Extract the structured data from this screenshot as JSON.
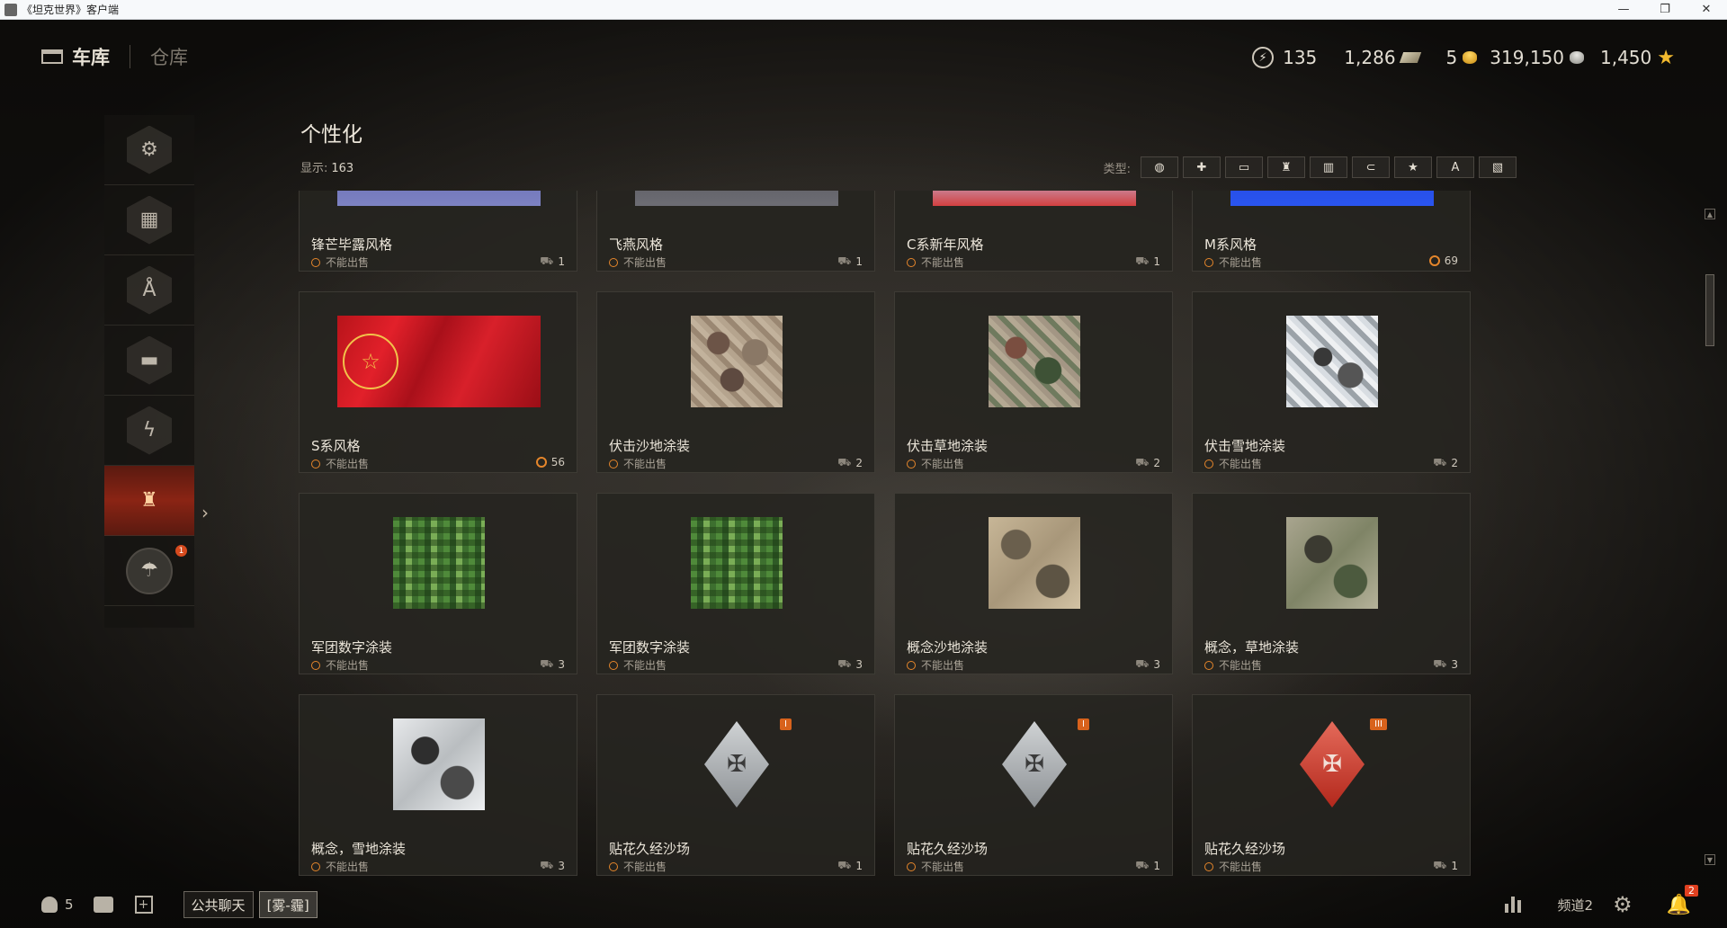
{
  "window": {
    "title": "《坦克世界》客户端",
    "buttons": [
      "—",
      "❐",
      "✕"
    ]
  },
  "header": {
    "garage_label": "车库",
    "depot_label": "仓库",
    "currencies": {
      "free_xp": "135",
      "bonds": "1,286",
      "gold_a": "5",
      "credits": "319,150",
      "crystal": "1,450"
    }
  },
  "sidebar": {
    "items": [
      {
        "icon": "equipment-icon"
      },
      {
        "icon": "ammo-crates-icon"
      },
      {
        "icon": "crew-icon"
      },
      {
        "icon": "tank-icon"
      },
      {
        "icon": "free-xp-icon"
      },
      {
        "icon": "brush-icon",
        "active": true
      },
      {
        "icon": "parachute-icon",
        "badge": "1"
      }
    ]
  },
  "main": {
    "title": "个性化",
    "count_label": "显示:",
    "count": "163",
    "filter_label": "类型:",
    "filters": [
      "paint-icon",
      "camo-icon",
      "emblem-icon",
      "brush-icon",
      "decal-icon",
      "projection-icon",
      "star-icon",
      "text-icon",
      "remove-icon"
    ]
  },
  "status_text": "不能出售",
  "cards": [
    {
      "name": "锋芒毕露风格",
      "qty": "1",
      "thumb": "banner",
      "fill": "fill-b1",
      "qty_type": "tank"
    },
    {
      "name": "飞燕风格",
      "qty": "1",
      "thumb": "banner",
      "fill": "fill-b2",
      "qty_type": "tank"
    },
    {
      "name": "C系新年风格",
      "qty": "1",
      "thumb": "banner",
      "fill": "fill-b3",
      "qty_type": "tank"
    },
    {
      "name": "M系风格",
      "qty": "69",
      "thumb": "banner",
      "fill": "fill-b4",
      "qty_type": "alt"
    },
    {
      "name": "S系风格",
      "qty": "56",
      "thumb": "banner",
      "fill": "fill-red",
      "qty_type": "alt"
    },
    {
      "name": "伏击沙地涂装",
      "qty": "2",
      "thumb": "square",
      "fill": "fill-sand",
      "qty_type": "tank"
    },
    {
      "name": "伏击草地涂装",
      "qty": "2",
      "thumb": "square",
      "fill": "fill-grass",
      "qty_type": "tank"
    },
    {
      "name": "伏击雪地涂装",
      "qty": "2",
      "thumb": "square",
      "fill": "fill-snow",
      "qty_type": "tank"
    },
    {
      "name": "军团数字涂装",
      "qty": "3",
      "thumb": "square",
      "fill": "fill-digital",
      "qty_type": "tank"
    },
    {
      "name": "军团数字涂装",
      "qty": "3",
      "thumb": "square",
      "fill": "fill-digital",
      "qty_type": "tank"
    },
    {
      "name": "概念沙地涂装",
      "qty": "3",
      "thumb": "square",
      "fill": "fill-c-sand",
      "qty_type": "tank"
    },
    {
      "name": "概念，草地涂装",
      "qty": "3",
      "thumb": "square",
      "fill": "fill-c-grass",
      "qty_type": "tank"
    },
    {
      "name": "概念，雪地涂装",
      "qty": "3",
      "thumb": "square",
      "fill": "fill-c-snow",
      "qty_type": "tank"
    },
    {
      "name": "贴花久经沙场",
      "qty": "1",
      "thumb": "decal",
      "decal": "grey",
      "level": "I",
      "qty_type": "tank"
    },
    {
      "name": "贴花久经沙场",
      "qty": "1",
      "thumb": "decal",
      "decal": "grey",
      "level": "I",
      "qty_type": "tank"
    },
    {
      "name": "贴花久经沙场",
      "qty": "1",
      "thumb": "decal",
      "decal": "red",
      "level": "III",
      "qty_type": "tank"
    }
  ],
  "bottom": {
    "friends_count": "5",
    "public_chat": "公共聊天",
    "clan_tag": "[雾-霾]",
    "channel": "频道2",
    "notifications": "2"
  }
}
